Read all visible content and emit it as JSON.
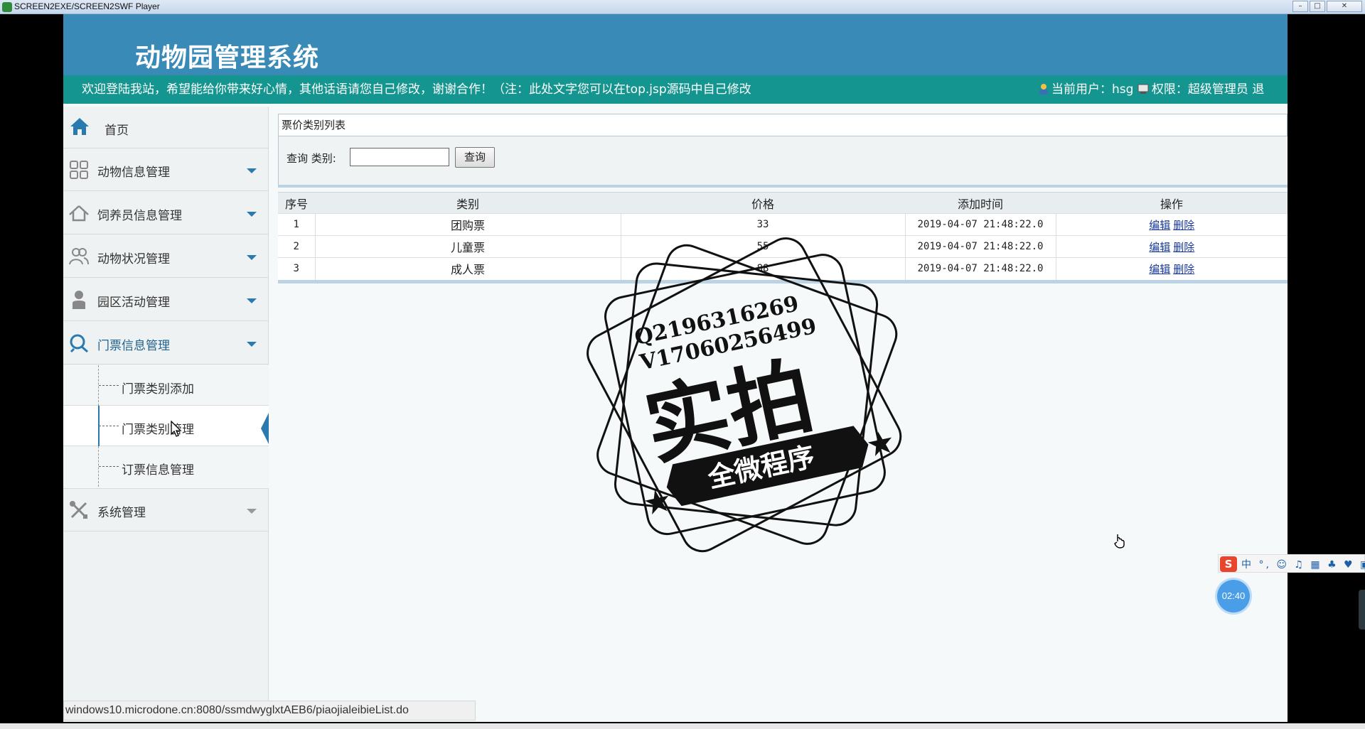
{
  "window": {
    "title": "SCREEN2EXE/SCREEN2SWF Player",
    "buttons": [
      "minimize",
      "maximize",
      "close"
    ]
  },
  "header": {
    "system_title": "动物园管理系统"
  },
  "notice": {
    "marquee_text": "欢迎登陆我站，希望能给你带来好心情，其他话语请您自己修改，谢谢合作！（注：此处文字您可以在top.jsp源码中自己修改",
    "current_user_label": "当前用户：hsg",
    "permission_label": "权限：超级管理员 退"
  },
  "sidebar": {
    "home_label": "首页",
    "items": [
      {
        "label": "动物信息管理",
        "icon": "grid-icon"
      },
      {
        "label": "饲养员信息管理",
        "icon": "house-icon"
      },
      {
        "label": "动物状况管理",
        "icon": "users-icon"
      },
      {
        "label": "园区活动管理",
        "icon": "user-icon"
      },
      {
        "label": "门票信息管理",
        "icon": "chat-icon"
      },
      {
        "label": "系统管理",
        "icon": "tools-icon"
      }
    ],
    "subitems": [
      {
        "label": "门票类别添加"
      },
      {
        "label": "门票类别管理"
      },
      {
        "label": "订票信息管理"
      }
    ]
  },
  "panel": {
    "title": "票价类别列表",
    "search_label": "查询 类别:",
    "search_value": "",
    "search_button": "查询"
  },
  "table": {
    "headers": [
      "序号",
      "类别",
      "价格",
      "添加时间",
      "操作"
    ],
    "rows": [
      {
        "no": "1",
        "category": "团购票",
        "price": "33",
        "added": "2019-04-07 21:48:22.0",
        "edit": "编辑",
        "delete": "删除"
      },
      {
        "no": "2",
        "category": "儿童票",
        "price": "55",
        "added": "2019-04-07 21:48:22.0",
        "edit": "编辑",
        "delete": "删除"
      },
      {
        "no": "3",
        "category": "成人票",
        "price": "88",
        "added": "2019-04-07 21:48:22.0",
        "edit": "编辑",
        "delete": "删除"
      }
    ]
  },
  "watermark": {
    "line1": "Q2196316269",
    "line2": "V17060256499",
    "main": "实拍",
    "banner": "全微程序"
  },
  "statusbar": {
    "url": "windows10.microdone.cn:8080/ssmdwyglxtAEB6/piaojialeibieList.do"
  },
  "ime": {
    "logo": "S",
    "glyphs": "中 °, ☺ ♫ ▦ ♣ ♥ ▣"
  },
  "timer": {
    "value": "02:40"
  },
  "colors": {
    "header": "#3a8ab8",
    "notice_bar": "#14958f",
    "accent": "#2a7ab0"
  }
}
